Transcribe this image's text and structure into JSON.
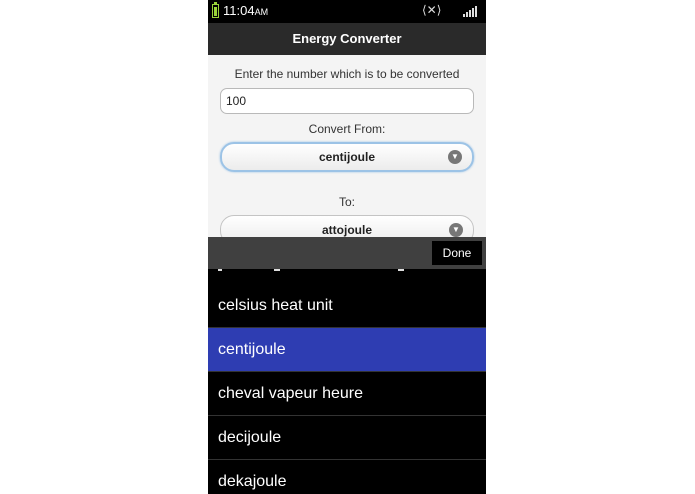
{
  "status": {
    "time": "11:04",
    "ampm": "AM"
  },
  "app": {
    "title": "Energy Converter"
  },
  "form": {
    "prompt_label": "Enter the number which is to be converted",
    "number_value": "100",
    "from_label": "Convert From:",
    "from_value": "centijoule",
    "to_label": "To:",
    "to_value": "attojoule"
  },
  "picker": {
    "done_label": "Done",
    "items": [
      {
        "label": "celsius heat unit",
        "selected": false
      },
      {
        "label": "centijoule",
        "selected": true
      },
      {
        "label": "cheval vapeur heure",
        "selected": false
      },
      {
        "label": "decijoule",
        "selected": false
      },
      {
        "label": "dekajoule",
        "selected": false
      }
    ],
    "selected_color": "#2e3db2"
  },
  "colors": {
    "battery": "#9ad33a",
    "focus_ring": "#9cc3e6"
  },
  "icons": [
    "battery-icon",
    "sync-icon",
    "signal-icon",
    "chevron-down-icon"
  ]
}
